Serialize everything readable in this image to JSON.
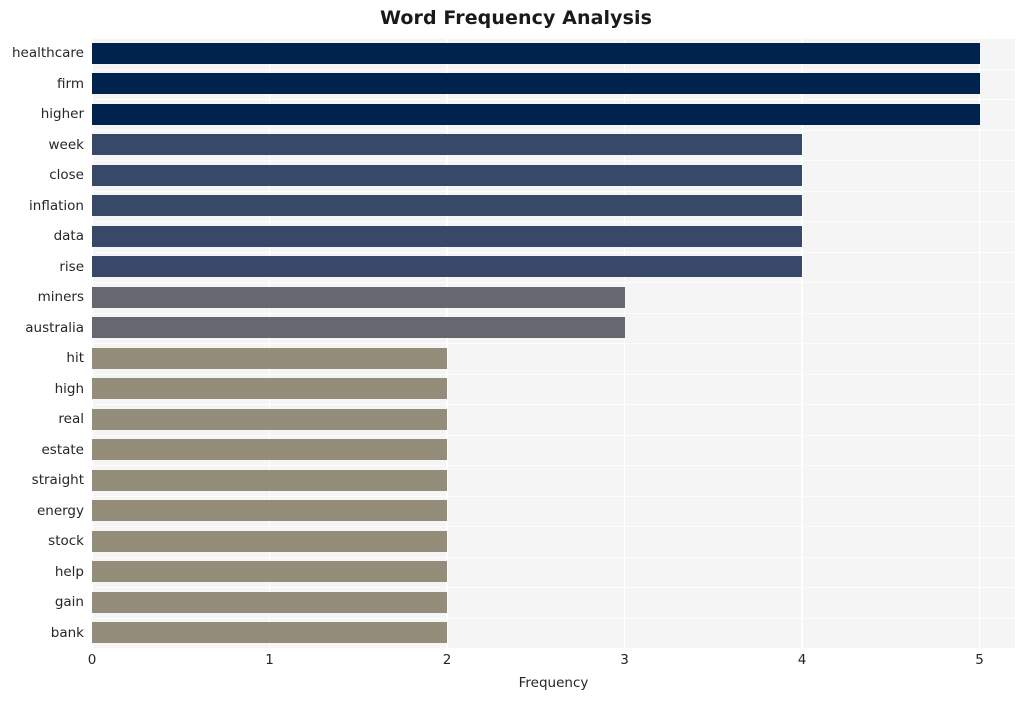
{
  "chart_data": {
    "type": "bar",
    "orientation": "horizontal",
    "title": "Word Frequency Analysis",
    "xlabel": "Frequency",
    "ylabel": "",
    "xlim": [
      0,
      5.2
    ],
    "xticks": [
      0,
      1,
      2,
      3,
      4,
      5
    ],
    "xtick_labels": [
      "0",
      "1",
      "2",
      "3",
      "4",
      "5"
    ],
    "grid": true,
    "legend": "none",
    "categories": [
      "healthcare",
      "firm",
      "higher",
      "week",
      "close",
      "inflation",
      "data",
      "rise",
      "miners",
      "australia",
      "hit",
      "high",
      "real",
      "estate",
      "straight",
      "energy",
      "stock",
      "help",
      "gain",
      "bank"
    ],
    "values": [
      5,
      5,
      5,
      4,
      4,
      4,
      4,
      4,
      3,
      3,
      2,
      2,
      2,
      2,
      2,
      2,
      2,
      2,
      2,
      2
    ],
    "bar_colors": [
      "#00234e",
      "#00234e",
      "#00234e",
      "#374869",
      "#374869",
      "#374869",
      "#374869",
      "#374869",
      "#65686f",
      "#65686f",
      "#938d79",
      "#938d79",
      "#938d79",
      "#938d79",
      "#938d79",
      "#938d79",
      "#938d79",
      "#938d79",
      "#938d79",
      "#938d79"
    ]
  },
  "style": {
    "figure_background": "#ffffff",
    "axes_background": "#f5f5f6",
    "grid_color": "#ffffff",
    "text_color": "#262626",
    "title_color": "#1a1a1a"
  }
}
